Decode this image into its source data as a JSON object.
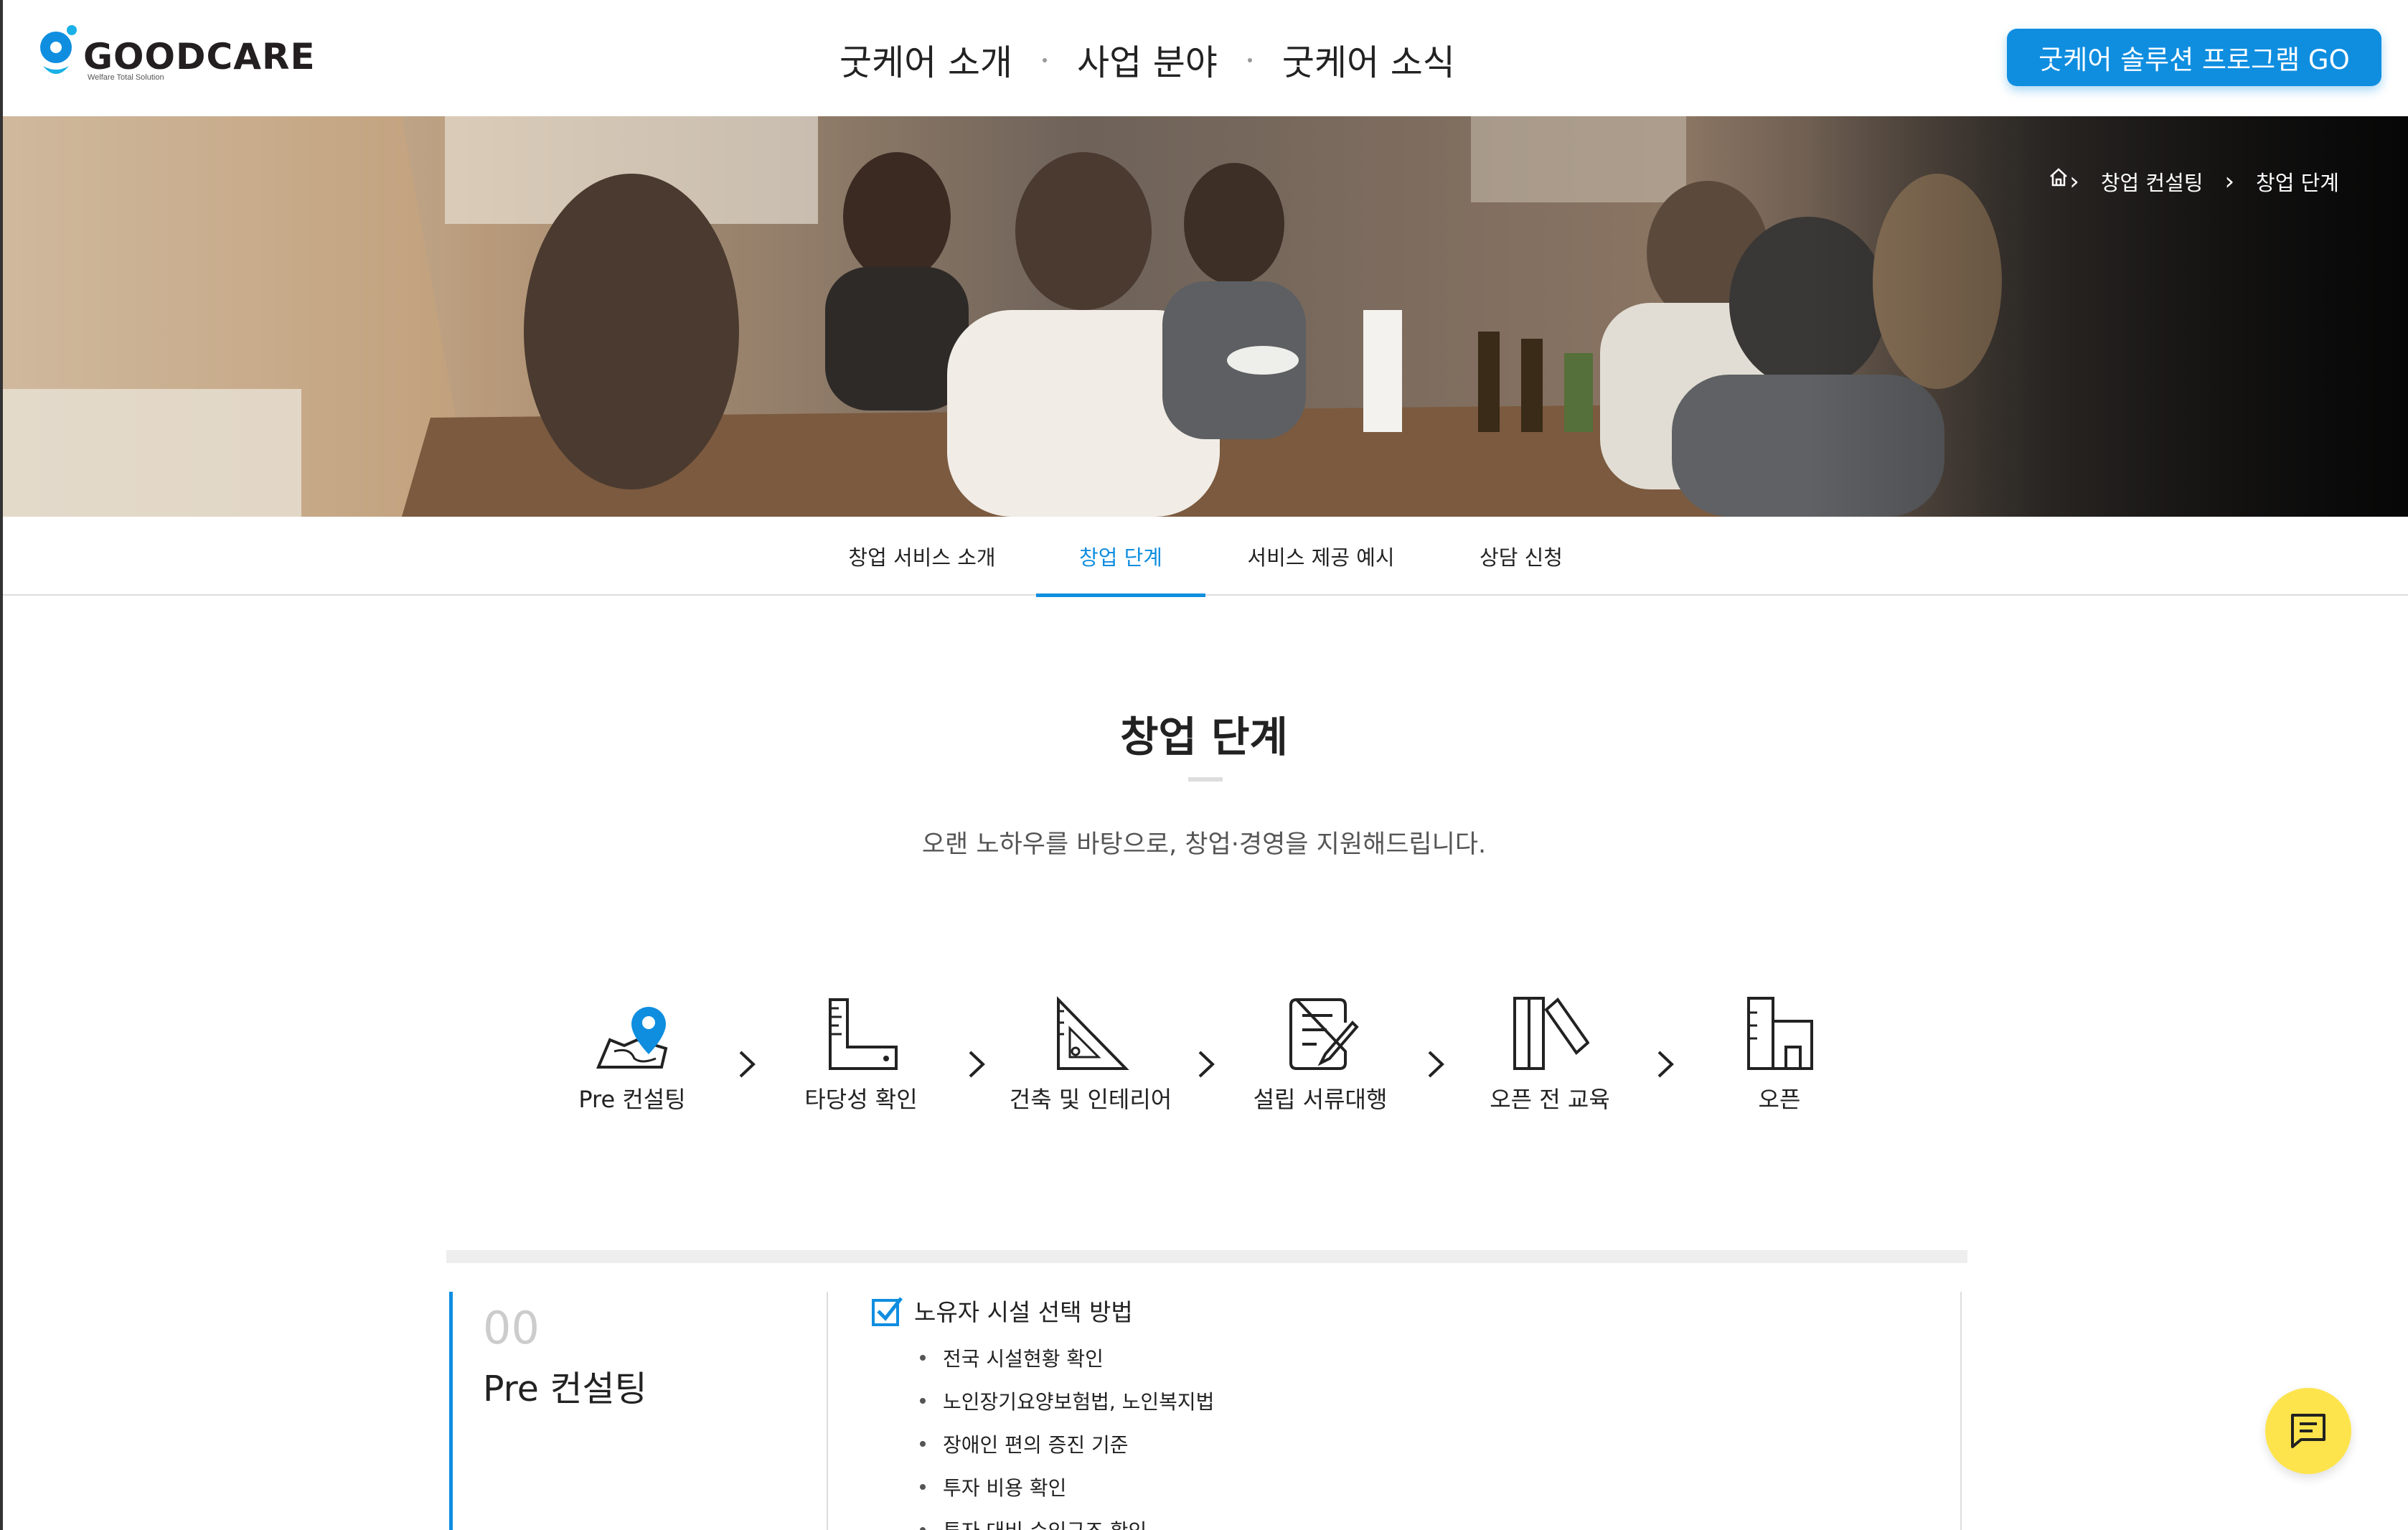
{
  "brand": {
    "logo_text": "GOODCARE",
    "logo_sub": "Welfare Total Solution",
    "accent": "#0f8ee0",
    "chat_color": "#fde44c"
  },
  "gnb": {
    "items": [
      "굿케어 소개",
      "사업 분야",
      "굿케어 소식"
    ]
  },
  "cta": {
    "label": "굿케어 솔루션 프로그램 GO"
  },
  "breadcrumb": {
    "home_icon": "home-icon",
    "items": [
      "창업 컨설팅",
      "창업 단계"
    ]
  },
  "subnav": {
    "tabs": [
      {
        "label": "창업 서비스 소개",
        "active": false
      },
      {
        "label": "창업 단계",
        "active": true
      },
      {
        "label": "서비스 제공 예시",
        "active": false
      },
      {
        "label": "상담 신청",
        "active": false
      }
    ]
  },
  "section": {
    "title": "창업 단계",
    "desc": "오랜 노하우를 바탕으로, 창업·경영을 지원해드립니다."
  },
  "steps": [
    {
      "label": "Pre 컨설팅",
      "icon": "map-pin-icon"
    },
    {
      "label": "타당성 확인",
      "icon": "ruler-icon"
    },
    {
      "label": "건축 및 인테리어",
      "icon": "set-square-icon"
    },
    {
      "label": "설립 서류대행",
      "icon": "document-pen-icon"
    },
    {
      "label": "오픈 전 교육",
      "icon": "books-icon"
    },
    {
      "label": "오픈",
      "icon": "building-icon"
    }
  ],
  "detail": {
    "number": "00",
    "name": "Pre 컨설팅",
    "check_title": "노유자 시설 선택 방법",
    "bullets": [
      "전국 시설현황 확인",
      "노인장기요양보험법, 노인복지법",
      "장애인 편의 증진 기준",
      "투자 비용 확인",
      "투자 대비 수익구조 확인"
    ]
  }
}
